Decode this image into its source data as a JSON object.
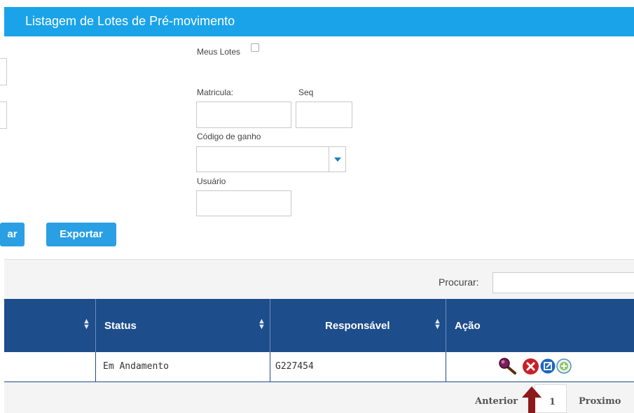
{
  "header": {
    "title": "Listagem de Lotes de Pré-movimento"
  },
  "filters": {
    "meus_lotes_label": "Meus Lotes",
    "matricula_label": "Matricula:",
    "seq_label": "Seq",
    "codigo_label": "Código de ganho",
    "usuario_label": "Usuário"
  },
  "buttons": {
    "partial_label": "ar",
    "exportar_label": "Exportar"
  },
  "search": {
    "label": "Procurar:"
  },
  "table": {
    "columns": [
      "Status",
      "Responsável",
      "Ação"
    ],
    "rows": [
      {
        "status": "Em Andamento",
        "responsavel": "G227454"
      }
    ]
  },
  "pagination": {
    "prev": "Anterior",
    "page": "1",
    "next": "Proximo"
  },
  "colors": {
    "title_bar": "#1aa3e8",
    "table_header": "#1e4d8c",
    "button": "#2a9fe4",
    "arrow": "#8b1a1a"
  },
  "icons": [
    "view-icon",
    "cancel-icon",
    "edit-icon",
    "add-icon"
  ]
}
